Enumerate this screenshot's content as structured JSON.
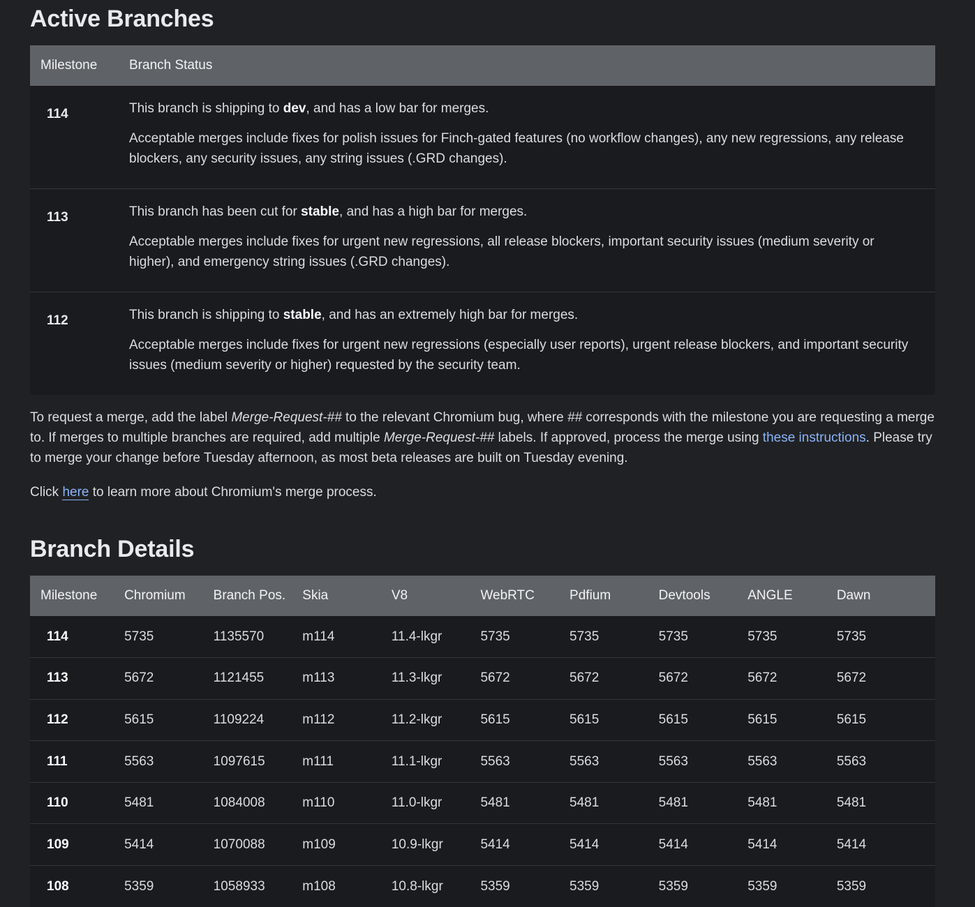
{
  "active": {
    "heading": "Active Branches",
    "columns": [
      "Milestone",
      "Branch Status"
    ],
    "rows": [
      {
        "milestone": "114",
        "line1_pre": "This branch is shipping to ",
        "line1_bold": "dev",
        "line1_post": ", and has a low bar for merges.",
        "line2": "Acceptable merges include fixes for polish issues for Finch-gated features (no workflow changes), any new regressions, any release blockers, any security issues, any string issues (.GRD changes)."
      },
      {
        "milestone": "113",
        "line1_pre": "This branch has been cut for ",
        "line1_bold": "stable",
        "line1_post": ", and has a high bar for merges.",
        "line2": "Acceptable merges include fixes for urgent new regressions, all release blockers, important security issues (medium severity or higher), and emergency string issues (.GRD changes)."
      },
      {
        "milestone": "112",
        "line1_pre": "This branch is shipping to ",
        "line1_bold": "stable",
        "line1_post": ", and has an extremely high bar for merges.",
        "line2": "Acceptable merges include fixes for urgent new regressions (especially user reports), urgent release blockers, and important security issues (medium severity or higher) requested by the security team."
      }
    ]
  },
  "merge_info": {
    "p1_a": "To request a merge, add the label ",
    "p1_em1": "Merge-Request-##",
    "p1_b": " to the relevant Chromium bug, where ",
    "p1_em2": "##",
    "p1_c": " corresponds with the milestone you are requesting a merge to. If merges to multiple branches are required, add multiple ",
    "p1_em3": "Merge-Request-##",
    "p1_d": " labels. If approved, process the merge using ",
    "p1_link": "these instructions",
    "p1_e": ". Please try to merge your change before Tuesday afternoon, as most beta releases are built on Tuesday evening.",
    "p2_a": "Click ",
    "p2_link": "here",
    "p2_b": " to learn more about Chromium's merge process."
  },
  "details": {
    "heading": "Branch Details",
    "columns": [
      "Milestone",
      "Chromium",
      "Branch Pos.",
      "Skia",
      "V8",
      "WebRTC",
      "Pdfium",
      "Devtools",
      "ANGLE",
      "Dawn"
    ],
    "rows": [
      [
        "114",
        "5735",
        "1135570",
        "m114",
        "11.4-lkgr",
        "5735",
        "5735",
        "5735",
        "5735",
        "5735"
      ],
      [
        "113",
        "5672",
        "1121455",
        "m113",
        "11.3-lkgr",
        "5672",
        "5672",
        "5672",
        "5672",
        "5672"
      ],
      [
        "112",
        "5615",
        "1109224",
        "m112",
        "11.2-lkgr",
        "5615",
        "5615",
        "5615",
        "5615",
        "5615"
      ],
      [
        "111",
        "5563",
        "1097615",
        "m111",
        "11.1-lkgr",
        "5563",
        "5563",
        "5563",
        "5563",
        "5563"
      ],
      [
        "110",
        "5481",
        "1084008",
        "m110",
        "11.0-lkgr",
        "5481",
        "5481",
        "5481",
        "5481",
        "5481"
      ],
      [
        "109",
        "5414",
        "1070088",
        "m109",
        "10.9-lkgr",
        "5414",
        "5414",
        "5414",
        "5414",
        "5414"
      ],
      [
        "108",
        "5359",
        "1058933",
        "m108",
        "10.8-lkgr",
        "5359",
        "5359",
        "5359",
        "5359",
        "5359"
      ]
    ]
  }
}
